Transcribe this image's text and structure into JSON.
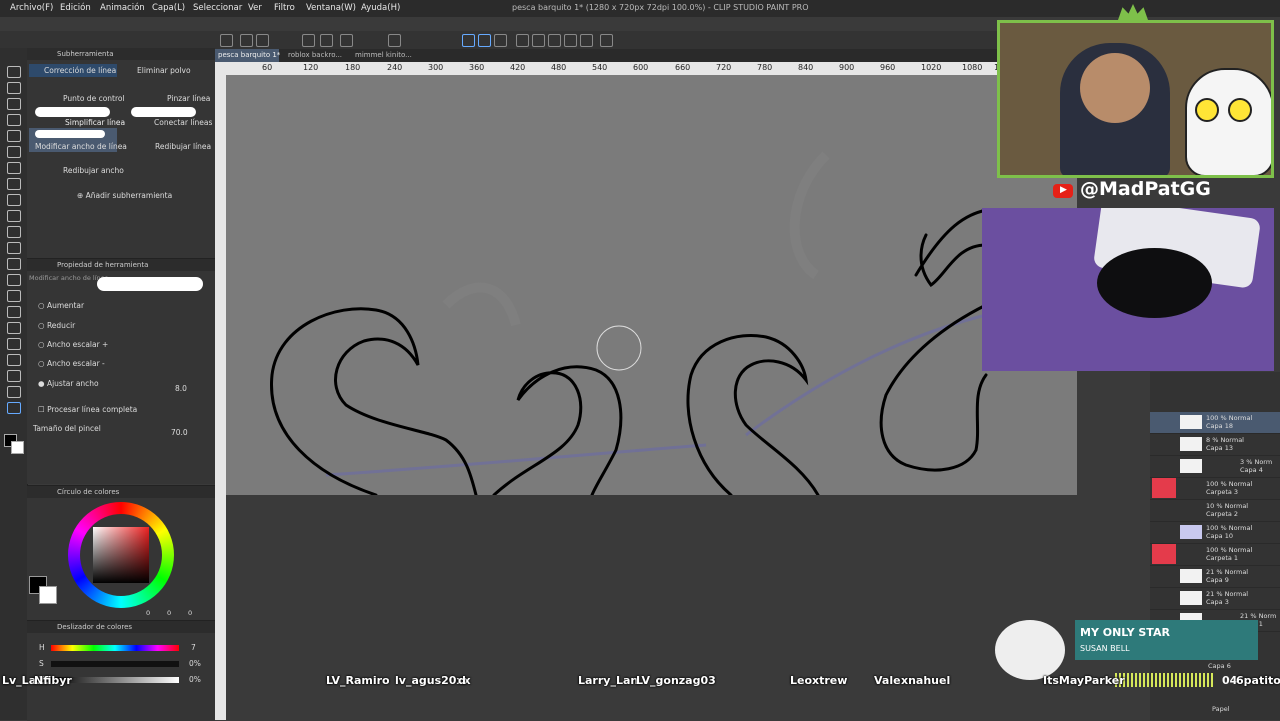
{
  "window_title": "pesca barquito 1* (1280 x 720px 72dpi 100.0%) - CLIP STUDIO PAINT PRO",
  "menu": [
    "Archivo(F)",
    "Edición",
    "Animación",
    "Capa(L)",
    "Seleccionar",
    "Ver",
    "Filtro",
    "Ventana(W)",
    "Ayuda(H)"
  ],
  "doc_tabs": [
    "pesca barquito 1*",
    "roblox backro...",
    "mimmel kinito..."
  ],
  "ruler_ticks": [
    "60",
    "120",
    "180",
    "240",
    "300",
    "360",
    "420",
    "480",
    "540",
    "600",
    "660",
    "720",
    "780",
    "840",
    "900",
    "960",
    "1020",
    "1080",
    "11"
  ],
  "subtool": {
    "header": "Subherramienta",
    "tab_active": "Corrección de línea",
    "tab_other": "Eliminar polvo",
    "items": [
      "Punto de control",
      "Pinzar línea",
      "Simplificar línea",
      "Conectar líneas",
      "Modificar ancho de línea",
      "Redibujar línea",
      "Redibujar ancho"
    ],
    "add_label": "Añadir subherramienta"
  },
  "tool_property": {
    "header": "Propiedad de herramienta",
    "current": "Modificar ancho de línea",
    "options": [
      "Aumentar",
      "Reducir",
      "Ancho escalar +",
      "Ancho escalar -",
      "Ajustar ancho"
    ],
    "ajustar_value": "8.0",
    "process_label": "Procesar línea completa",
    "brush_size_label": "Tamaño del pincel",
    "brush_size_value": "70.0"
  },
  "color_panel": {
    "header": "Círculo de colores",
    "values": [
      "0",
      "0",
      "0"
    ]
  },
  "slider_panel": {
    "header": "Deslizador de colores",
    "labels": [
      "H",
      "S",
      "V"
    ],
    "values": [
      "7",
      "0%",
      "0%"
    ]
  },
  "stream": {
    "handle": "@MadPatGG",
    "now_playing_title": "MY ONLY STAR",
    "now_playing_artist": "SUSAN BELL",
    "timer": "04:",
    "viewers": [
      "Lv_La...",
      "Nfibyr",
      "LV_Ramiro",
      "lv_agus20xx",
      "d",
      "Larry_Lan",
      "LV_gonzag03",
      "Leoxtrew",
      "Vale",
      "xnahuel",
      "ItsMayParker",
      "6patito"
    ]
  },
  "layers": [
    {
      "pct": "100 %",
      "mode": "Normal",
      "name": "Capa 18",
      "red": false
    },
    {
      "pct": "8 %",
      "mode": "Normal",
      "name": "Capa 13",
      "red": false
    },
    {
      "pct": "3 %",
      "mode": "Norm",
      "name": "Capa 4",
      "red": false
    },
    {
      "pct": "100 %",
      "mode": "Normal",
      "name": "Carpeta 3",
      "red": true
    },
    {
      "pct": "10 %",
      "mode": "Normal",
      "name": "Carpeta 2",
      "red": false
    },
    {
      "pct": "100 %",
      "mode": "Normal",
      "name": "Capa 10",
      "red": false
    },
    {
      "pct": "100 %",
      "mode": "Normal",
      "name": "Carpeta 1",
      "red": true
    },
    {
      "pct": "21 %",
      "mode": "Normal",
      "name": "Capa 9",
      "red": false
    },
    {
      "pct": "21 %",
      "mode": "Normal",
      "name": "Capa 3",
      "red": false
    },
    {
      "pct": "21 %",
      "mode": "Norm",
      "name": "Capa 1",
      "red": false
    }
  ],
  "layer_footer": [
    "Capa 6",
    "Papel"
  ],
  "accent_colors": {
    "stream_green": "#7ec04a",
    "layer_red": "#e43b4b",
    "now_playing": "#2e7a7a"
  }
}
